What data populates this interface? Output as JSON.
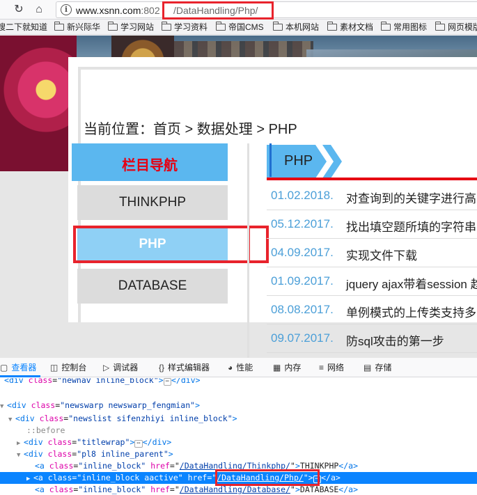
{
  "browser": {
    "url_host": "www.xsnn.com",
    "url_port": ":802",
    "url_path": "/DataHandling/Php/",
    "bookmarks": [
      "搜二下就知道",
      "新兴际华",
      "学习网站",
      "学习资料",
      "帝国CMS",
      "本机网站",
      "素材文档",
      "常用图标",
      "网页模版"
    ]
  },
  "page": {
    "breadcrumb": "当前位置：首页 > 数据处理 > PHP",
    "sidebar": {
      "title": "栏目导航",
      "items": [
        "THINKPHP",
        "PHP",
        "DATABASE"
      ],
      "active_index": 1
    },
    "tab_label": "PHP",
    "news": [
      {
        "date": "01.02.2018.",
        "title": "对查询到的关键字进行高"
      },
      {
        "date": "05.12.2017.",
        "title": "找出填空题所填的字符串"
      },
      {
        "date": "04.09.2017.",
        "title": "实现文件下载"
      },
      {
        "date": "01.09.2017.",
        "title": "jquery ajax带着session 趋"
      },
      {
        "date": "08.08.2017.",
        "title": "单例模式的上传类支持多"
      },
      {
        "date": "09.07.2017.",
        "title": "防sql攻击的第一步"
      }
    ]
  },
  "devtools": {
    "tabs": [
      "查看器",
      "控制台",
      "调试器",
      "样式编辑器",
      "性能",
      "内存",
      "网络",
      "存储"
    ],
    "active_tab": "查看器",
    "dom": {
      "l0_tag": "div",
      "l0_attr": "class",
      "l0_val": "\"newnav inline_block\"",
      "l0_close": "</div>",
      "l1_tag": "div",
      "l1_attr": "class",
      "l1_val": "\"newswarp newswarp_fengmian\"",
      "l2_tag": "div",
      "l2_attr": "class",
      "l2_val": "\"newslist sifenzhiyi inline_block\"",
      "l3_pseudo": "::before",
      "l4_tag": "div",
      "l4_attr": "class",
      "l4_val": "\"titlewrap\"",
      "l4_close": "</div>",
      "l5_tag": "div",
      "l5_attr": "class",
      "l5_val": "\"pl8 inline_parent\"",
      "a1_class": "\"inline_block\"",
      "a1_href": "/DataHandling/Thinkphp/",
      "a1_text": "THINKPHP",
      "a2_class": "\"inline_block aactive\"",
      "a2_href": "/DataHandling/Php/",
      "a3_class": "\"inline_block\"",
      "a3_href": "/DataHandling/Database/",
      "a3_text": "DATABASE"
    }
  },
  "colors": {
    "accent_blue": "#5bb7ef",
    "active_item": "#8fd0f5",
    "red_highlight": "#e8232c",
    "date_blue": "#4b9fd8"
  }
}
